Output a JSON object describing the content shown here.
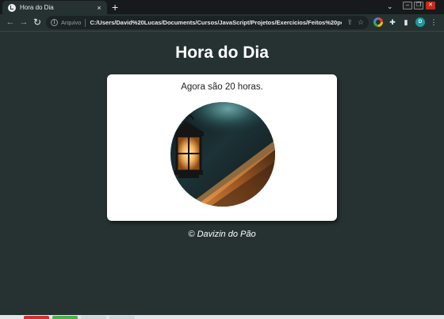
{
  "browser": {
    "tab": {
      "title": "Hora do Dia",
      "close": "×"
    },
    "new_tab": "+",
    "tab_search": "⌄",
    "window": {
      "minimize": "–",
      "restore": "❐",
      "close": "✕"
    },
    "nav": {
      "back": "←",
      "forward": "→",
      "reload": "↻"
    },
    "omnibox": {
      "info": "i",
      "scheme_label": "Arquivo",
      "url": "C:/Users/David%20Lucas/Documents/Cursos/JavaScript/Projetos/Exercicios/Feitos%20por%..."
    },
    "toolbar_icons": {
      "share": "⇪",
      "star": "☆",
      "extensions": "✚",
      "sidebar": "▮",
      "profile": "D"
    }
  },
  "page": {
    "title": "Hora do Dia",
    "message": "Agora são 20 horas.",
    "image_alt": "night-lantern-photo",
    "footer": "© Davizin do Pão"
  },
  "colors": {
    "background": "#263232",
    "card": "#ffffff",
    "tab_strip": "#161a1b"
  }
}
